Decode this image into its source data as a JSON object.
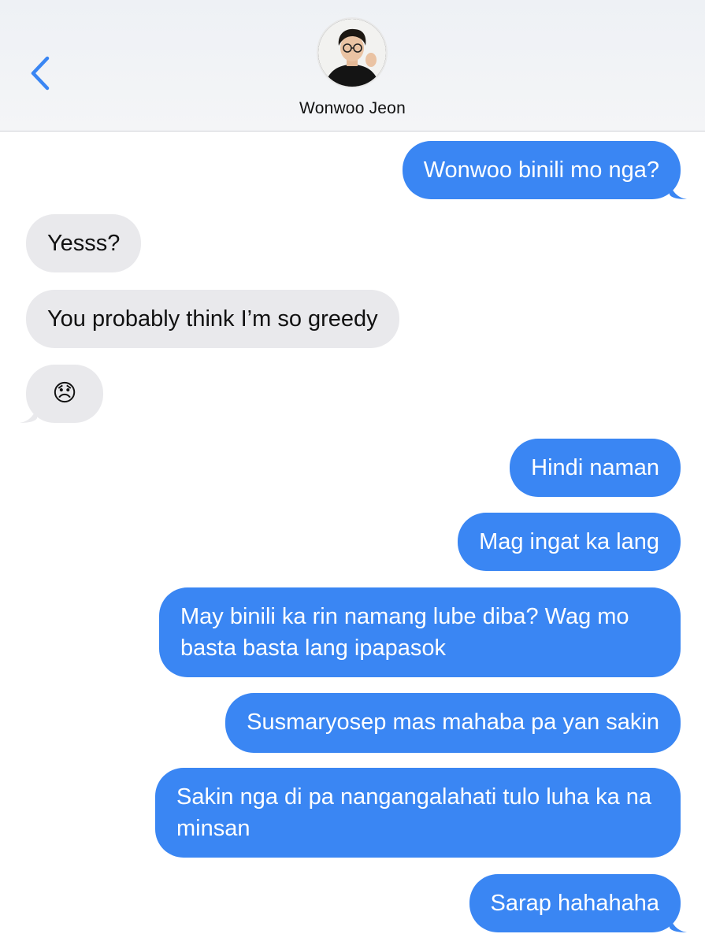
{
  "header": {
    "contact_name": "Wonwoo Jeon"
  },
  "colors": {
    "outgoing_bubble": "#3a86f3",
    "incoming_bubble": "#e9e9ec",
    "accent": "#3a86f3"
  },
  "icons": {
    "back": "chevron-left-icon",
    "avatar": "contact-avatar",
    "sad_emoji": "disappointed-face-emoji"
  },
  "messages": [
    {
      "from": "me",
      "text": "Wonwoo binili mo nga?"
    },
    {
      "from": "them",
      "text": "Yesss?"
    },
    {
      "from": "them",
      "text": "You probably think I’m so greedy"
    },
    {
      "from": "them",
      "text": "😞"
    },
    {
      "from": "me",
      "text": "Hindi naman"
    },
    {
      "from": "me",
      "text": "Mag ingat ka lang"
    },
    {
      "from": "me",
      "text": "May binili ka rin namang lube diba? Wag mo basta basta lang ipapasok"
    },
    {
      "from": "me",
      "text": "Susmaryosep mas mahaba pa yan sakin"
    },
    {
      "from": "me",
      "text": "Sakin nga di pa nangangalahati tulo luha ka na minsan"
    },
    {
      "from": "me",
      "text": "Sarap hahahaha"
    }
  ]
}
